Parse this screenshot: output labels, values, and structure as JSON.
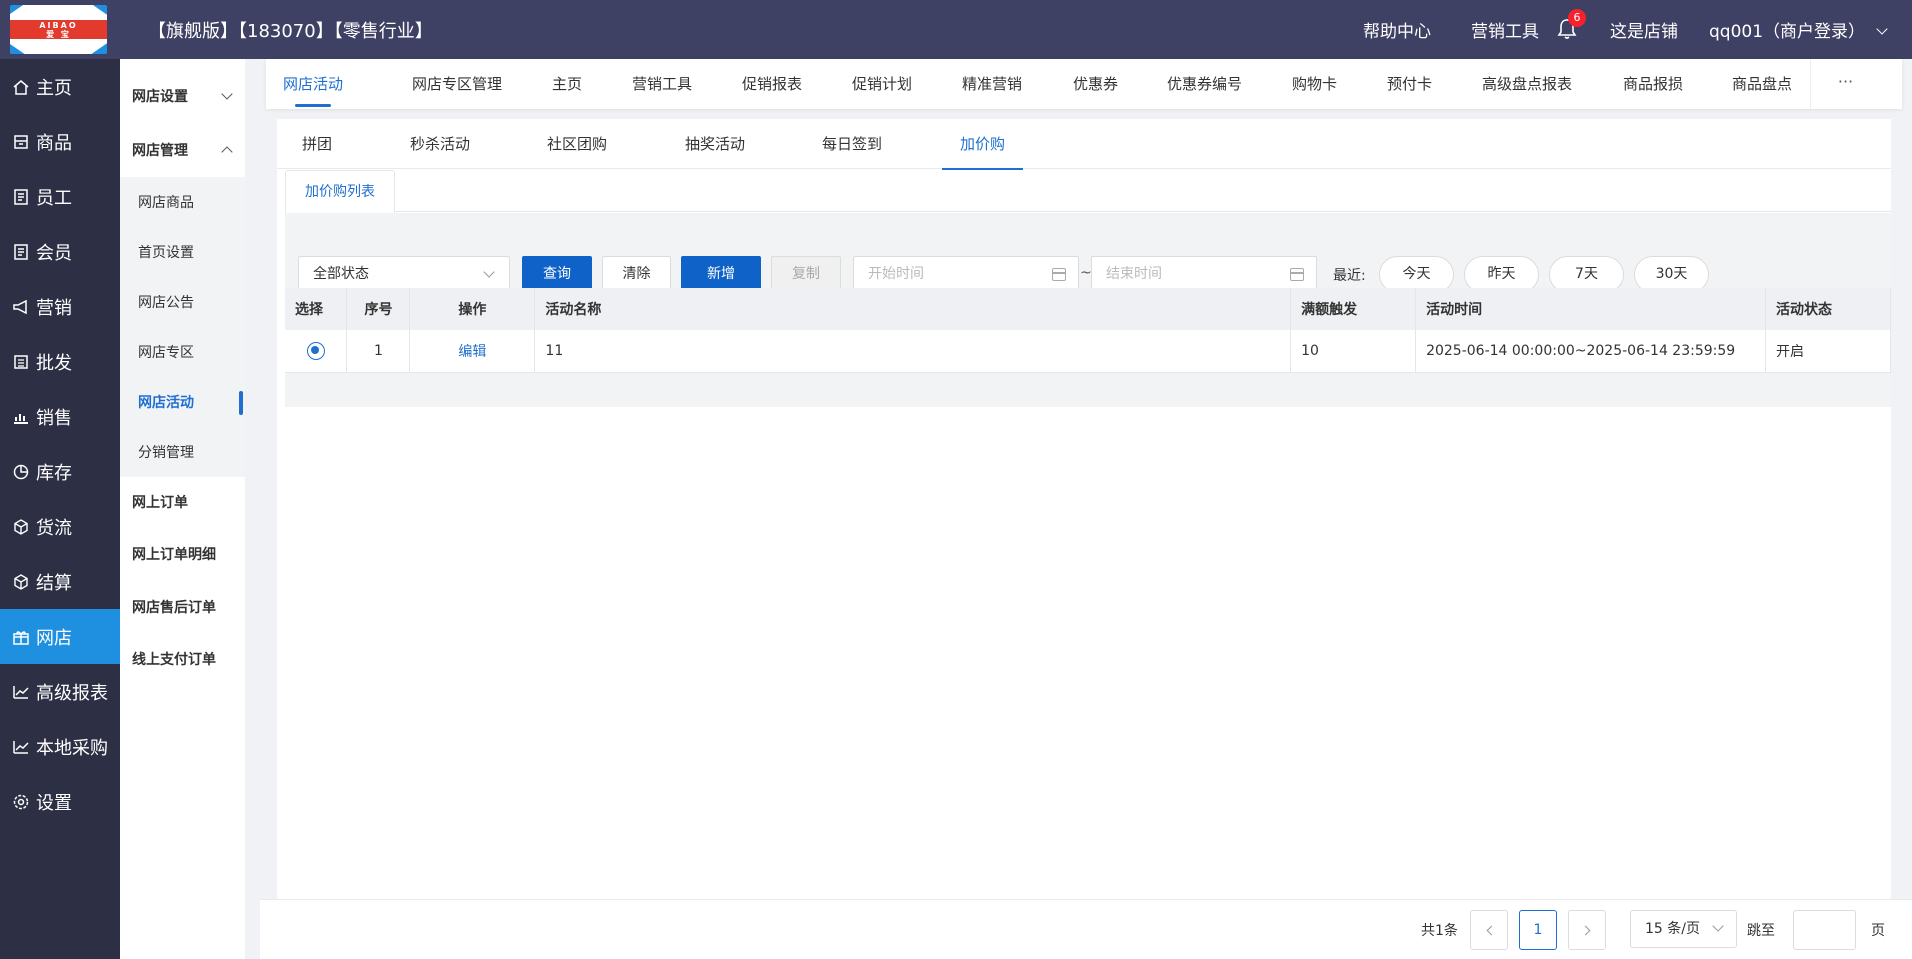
{
  "header": {
    "logo_top": "AIBAO",
    "logo_bottom": "爱 宝",
    "title": "【旗舰版】【183070】【零售行业】",
    "help": "帮助中心",
    "marketing": "营销工具",
    "notifications": "6",
    "shop": "这是店铺",
    "user": "qq001（商户登录）"
  },
  "sidebar": {
    "items": [
      {
        "label": "主页",
        "icon": "home-icon"
      },
      {
        "label": "商品",
        "icon": "goods-icon"
      },
      {
        "label": "员工",
        "icon": "staff-icon"
      },
      {
        "label": "会员",
        "icon": "member-icon"
      },
      {
        "label": "营销",
        "icon": "megaphone-icon"
      },
      {
        "label": "批发",
        "icon": "wholesale-icon"
      },
      {
        "label": "销售",
        "icon": "sales-chart-icon"
      },
      {
        "label": "库存",
        "icon": "pie-icon"
      },
      {
        "label": "货流",
        "icon": "flow-icon"
      },
      {
        "label": "结算",
        "icon": "settle-icon"
      },
      {
        "label": "网店",
        "icon": "shop-icon"
      },
      {
        "label": "高级报表",
        "icon": "report-icon"
      },
      {
        "label": "本地采购",
        "icon": "purchase-icon"
      },
      {
        "label": "设置",
        "icon": "gear-icon"
      }
    ],
    "active_index": 10
  },
  "subsidebar": {
    "group1": "网店设置",
    "group2": "网店管理",
    "children": [
      "网店商品",
      "首页设置",
      "网店公告",
      "网店专区",
      "网店活动",
      "分销管理"
    ],
    "active_child": "网店活动",
    "flat": [
      "网上订单",
      "网上订单明细",
      "网店售后订单",
      "线上支付订单"
    ]
  },
  "topnav": {
    "items": [
      "网店活动",
      "网店专区管理",
      "主页",
      "营销工具",
      "促销报表",
      "促销计划",
      "精准营销",
      "优惠券",
      "优惠券编号",
      "购物卡",
      "预付卡",
      "高级盘点报表",
      "商品报损",
      "商品盘点"
    ],
    "more": "···"
  },
  "subtabs": [
    "拼团",
    "秒杀活动",
    "社区团购",
    "抽奖活动",
    "每日签到",
    "加价购"
  ],
  "cardtab": "加价购列表",
  "filters": {
    "status": "全部状态",
    "query": "查询",
    "clear": "清除",
    "add": "新增",
    "copy": "复制",
    "start_placeholder": "开始时间",
    "end_placeholder": "结束时间",
    "tilde": "~",
    "recent": "最近:",
    "quick": [
      "今天",
      "昨天",
      "7天",
      "30天"
    ]
  },
  "table": {
    "headers": [
      "选择",
      "序号",
      "操作",
      "活动名称",
      "满额触发",
      "活动时间",
      "活动状态"
    ],
    "rows": [
      {
        "index": "1",
        "action": "编辑",
        "name": "11",
        "threshold": "10",
        "time": "2025-06-14 00:00:00~2025-06-14 23:59:59",
        "status": "开启"
      }
    ]
  },
  "pager": {
    "total": "共1条",
    "current": "1",
    "size": "15 条/页",
    "jump": "跳至",
    "page": "页"
  }
}
